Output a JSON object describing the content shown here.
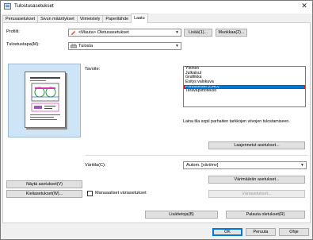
{
  "window": {
    "title": "Tulostusasetukset",
    "close_glyph": "✕"
  },
  "tabs": [
    {
      "label": "Perusasetukset",
      "active": false
    },
    {
      "label": "Sivun määritykset",
      "active": false
    },
    {
      "label": "Viimeistely",
      "active": false
    },
    {
      "label": "Paperilähde",
      "active": false
    },
    {
      "label": "Laatu",
      "active": true
    }
  ],
  "profile": {
    "label": "Profiili:",
    "value": "<Muuta> Oletusasetukset",
    "add_button": "Lisää(1)...",
    "edit_button": "Muokkaa(2)..."
  },
  "output_method": {
    "label": "Tulostustapa(M):",
    "value": "Tulosta"
  },
  "goal": {
    "label": "Tavoite:",
    "items": [
      "Yleinen",
      "Julkaisut",
      "Grafiikka",
      "Esitys valokuva",
      "Piirustukset (CAD)",
      "Teräväpiirtoteksti"
    ],
    "selected_index": 4
  },
  "description": "Laina tila sopii parhaiten tarkkojen viivojen tulostamiseen.",
  "advanced_button": "Laajennetut asetukset...",
  "color": {
    "label": "Väritila(C):",
    "value": "Autom. [väri/mv]",
    "color_settings_button": "Värimäärän asetukset...",
    "disabled_button": "Väriasetukset..."
  },
  "left_buttons": {
    "show_settings": "Näytä asetukset(V)",
    "language_settings": "Kieliasetukset(W)..."
  },
  "manual_checkbox": {
    "label": "Manuaaliset väriasetukset",
    "checked": false
  },
  "bottom_buttons": {
    "restore": "Palauta oletukset(R)",
    "extra": "Lisätietoja(B)"
  },
  "dialog_buttons": {
    "ok": "OK",
    "cancel": "Peruuta",
    "help": "Ohje"
  },
  "colors": {
    "accent": "#0078d7",
    "preview_bg": "#cde5f7",
    "highlight_border": "#e11111"
  },
  "icons": {
    "output_method": "printer-icon",
    "profile": "pencil-icon",
    "window": "printer-settings-icon"
  }
}
